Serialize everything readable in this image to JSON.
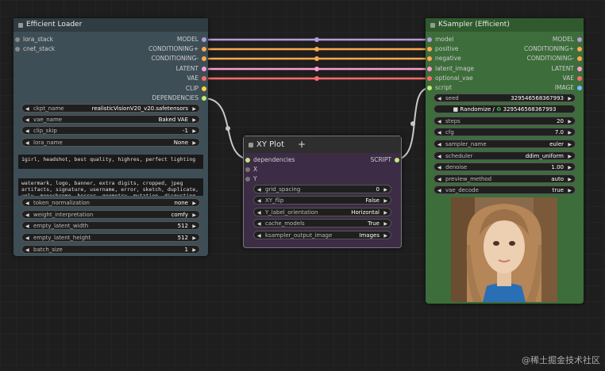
{
  "loader": {
    "title": "Efficient Loader",
    "inputs": [
      {
        "label": "lora_stack"
      },
      {
        "label": "cnet_stack"
      }
    ],
    "outputs": [
      {
        "label": "MODEL",
        "color": "#b39ddb"
      },
      {
        "label": "CONDITIONING+",
        "color": "#ffa94d"
      },
      {
        "label": "CONDITIONING-",
        "color": "#ffa94d"
      },
      {
        "label": "LATENT",
        "color": "#ff9ccf"
      },
      {
        "label": "VAE",
        "color": "#ff6b6b"
      },
      {
        "label": "CLIP",
        "color": "#ffd43b"
      },
      {
        "label": "DEPENDENCIES",
        "color": "#c0eb75"
      }
    ],
    "widgets_top": [
      {
        "label": "ckpt_name",
        "value": "realisticVisionV20_v20.safetensors"
      },
      {
        "label": "vae_name",
        "value": "Baked VAE"
      },
      {
        "label": "clip_skip",
        "value": "-1"
      },
      {
        "label": "lora_name",
        "value": "None"
      }
    ],
    "positive_prompt": "1girl, headshot, best quality, highres, perfect lighting",
    "negative_prompt": "watermark, logo, banner, extra digits, cropped, jpeg artifacts, signature, username, error, sketch, duplicate, ugly, monochrome, horror, geometry, mutation, disgusting",
    "widgets_bottom": [
      {
        "label": "token_normalization",
        "value": "none"
      },
      {
        "label": "weight_interpretation",
        "value": "comfy"
      },
      {
        "label": "empty_latent_width",
        "value": "512"
      },
      {
        "label": "empty_latent_height",
        "value": "512"
      },
      {
        "label": "batch_size",
        "value": "1"
      }
    ]
  },
  "xyplot": {
    "title": "XY Plot",
    "inputs": [
      {
        "label": "dependencies",
        "color": "#c0eb75"
      },
      {
        "label": "X",
        "color": "#888888"
      },
      {
        "label": "Y",
        "color": "#888888"
      }
    ],
    "output": {
      "label": "SCRIPT",
      "color": "#c0eb75"
    },
    "widgets": [
      {
        "label": "grid_spacing",
        "value": "0"
      },
      {
        "label": "XY_flip",
        "value": "False"
      },
      {
        "label": "Y_label_orientation",
        "value": "Horizontal"
      },
      {
        "label": "cache_models",
        "value": "True"
      },
      {
        "label": "ksampler_output_image",
        "value": "Images"
      }
    ]
  },
  "ksampler": {
    "title": "KSampler (Efficient)",
    "inputs": [
      {
        "label": "model",
        "color": "#b39ddb"
      },
      {
        "label": "positive",
        "color": "#ffa94d"
      },
      {
        "label": "negative",
        "color": "#ffa94d"
      },
      {
        "label": "latent_image",
        "color": "#ff9ccf"
      },
      {
        "label": "optional_vae",
        "color": "#ff6b6b"
      },
      {
        "label": "script",
        "color": "#c0eb75"
      }
    ],
    "outputs": [
      {
        "label": "MODEL",
        "color": "#b39ddb"
      },
      {
        "label": "CONDITIONING+",
        "color": "#ffa94d"
      },
      {
        "label": "CONDITIONING-",
        "color": "#ffa94d"
      },
      {
        "label": "LATENT",
        "color": "#ff9ccf"
      },
      {
        "label": "VAE",
        "color": "#ff6b6b"
      },
      {
        "label": "IMAGE",
        "color": "#74c0fc"
      }
    ],
    "seed": {
      "label": "seed",
      "value": "329546568367993"
    },
    "randomize": {
      "label": "Randomize /",
      "value": "329546568367993"
    },
    "widgets": [
      {
        "label": "steps",
        "value": "20"
      },
      {
        "label": "cfg",
        "value": "7.0"
      },
      {
        "label": "sampler_name",
        "value": "euler"
      },
      {
        "label": "scheduler",
        "value": "ddim_uniform"
      },
      {
        "label": "denoise",
        "value": "1.00"
      },
      {
        "label": "preview_method",
        "value": "auto"
      },
      {
        "label": "vae_decode",
        "value": "true"
      }
    ]
  },
  "watermark": "@稀土掘金技术社区"
}
